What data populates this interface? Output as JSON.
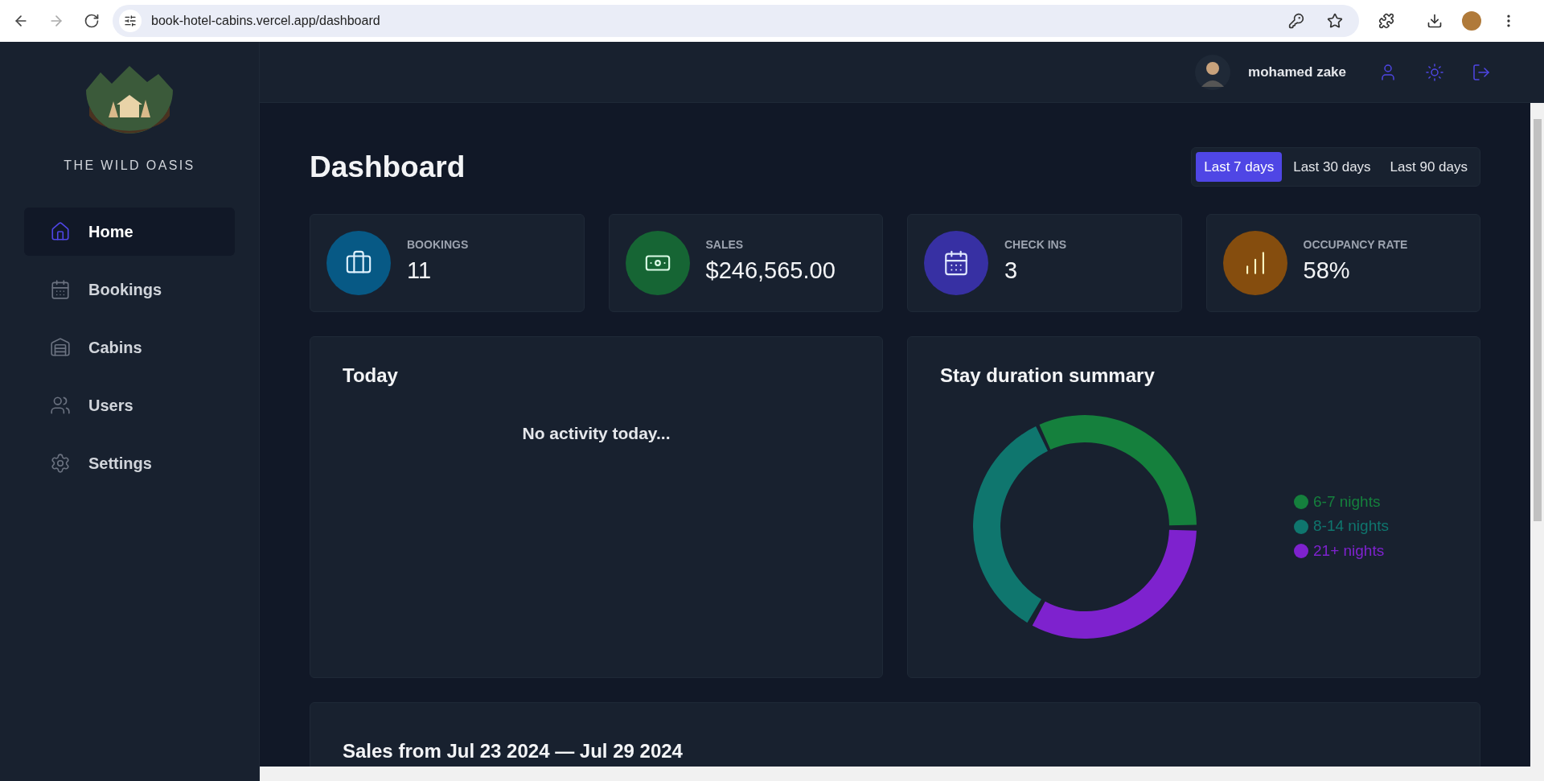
{
  "browser": {
    "url": "book-hotel-cabins.vercel.app/dashboard"
  },
  "brand": {
    "name": "THE WILD OASIS"
  },
  "sidebar": {
    "items": [
      {
        "label": "Home",
        "selected": true
      },
      {
        "label": "Bookings",
        "selected": false
      },
      {
        "label": "Cabins",
        "selected": false
      },
      {
        "label": "Users",
        "selected": false
      },
      {
        "label": "Settings",
        "selected": false
      }
    ]
  },
  "header": {
    "user_name": "mohamed zake"
  },
  "page": {
    "title": "Dashboard"
  },
  "filters": [
    {
      "label": "Last 7 days",
      "selected": true
    },
    {
      "label": "Last 30 days",
      "selected": false
    },
    {
      "label": "Last 90 days",
      "selected": false
    }
  ],
  "stats": [
    {
      "label": "BOOKINGS",
      "value": "11",
      "color": "#075985"
    },
    {
      "label": "SALES",
      "value": "$246,565.00",
      "color": "#166534"
    },
    {
      "label": "CHECK INS",
      "value": "3",
      "color": "#3730a3"
    },
    {
      "label": "OCCUPANCY RATE",
      "value": "58%",
      "color": "#854d0e"
    }
  ],
  "today": {
    "title": "Today",
    "empty_message": "No activity today..."
  },
  "stay_duration": {
    "title": "Stay duration summary",
    "legend": [
      {
        "label": "6-7 nights",
        "color": "#15803d"
      },
      {
        "label": "8-14 nights",
        "color": "#0f766e"
      },
      {
        "label": "21+ nights",
        "color": "#7e22ce"
      }
    ]
  },
  "sales": {
    "title": "Sales from Jul 23 2024 — Jul 29 2024"
  }
}
